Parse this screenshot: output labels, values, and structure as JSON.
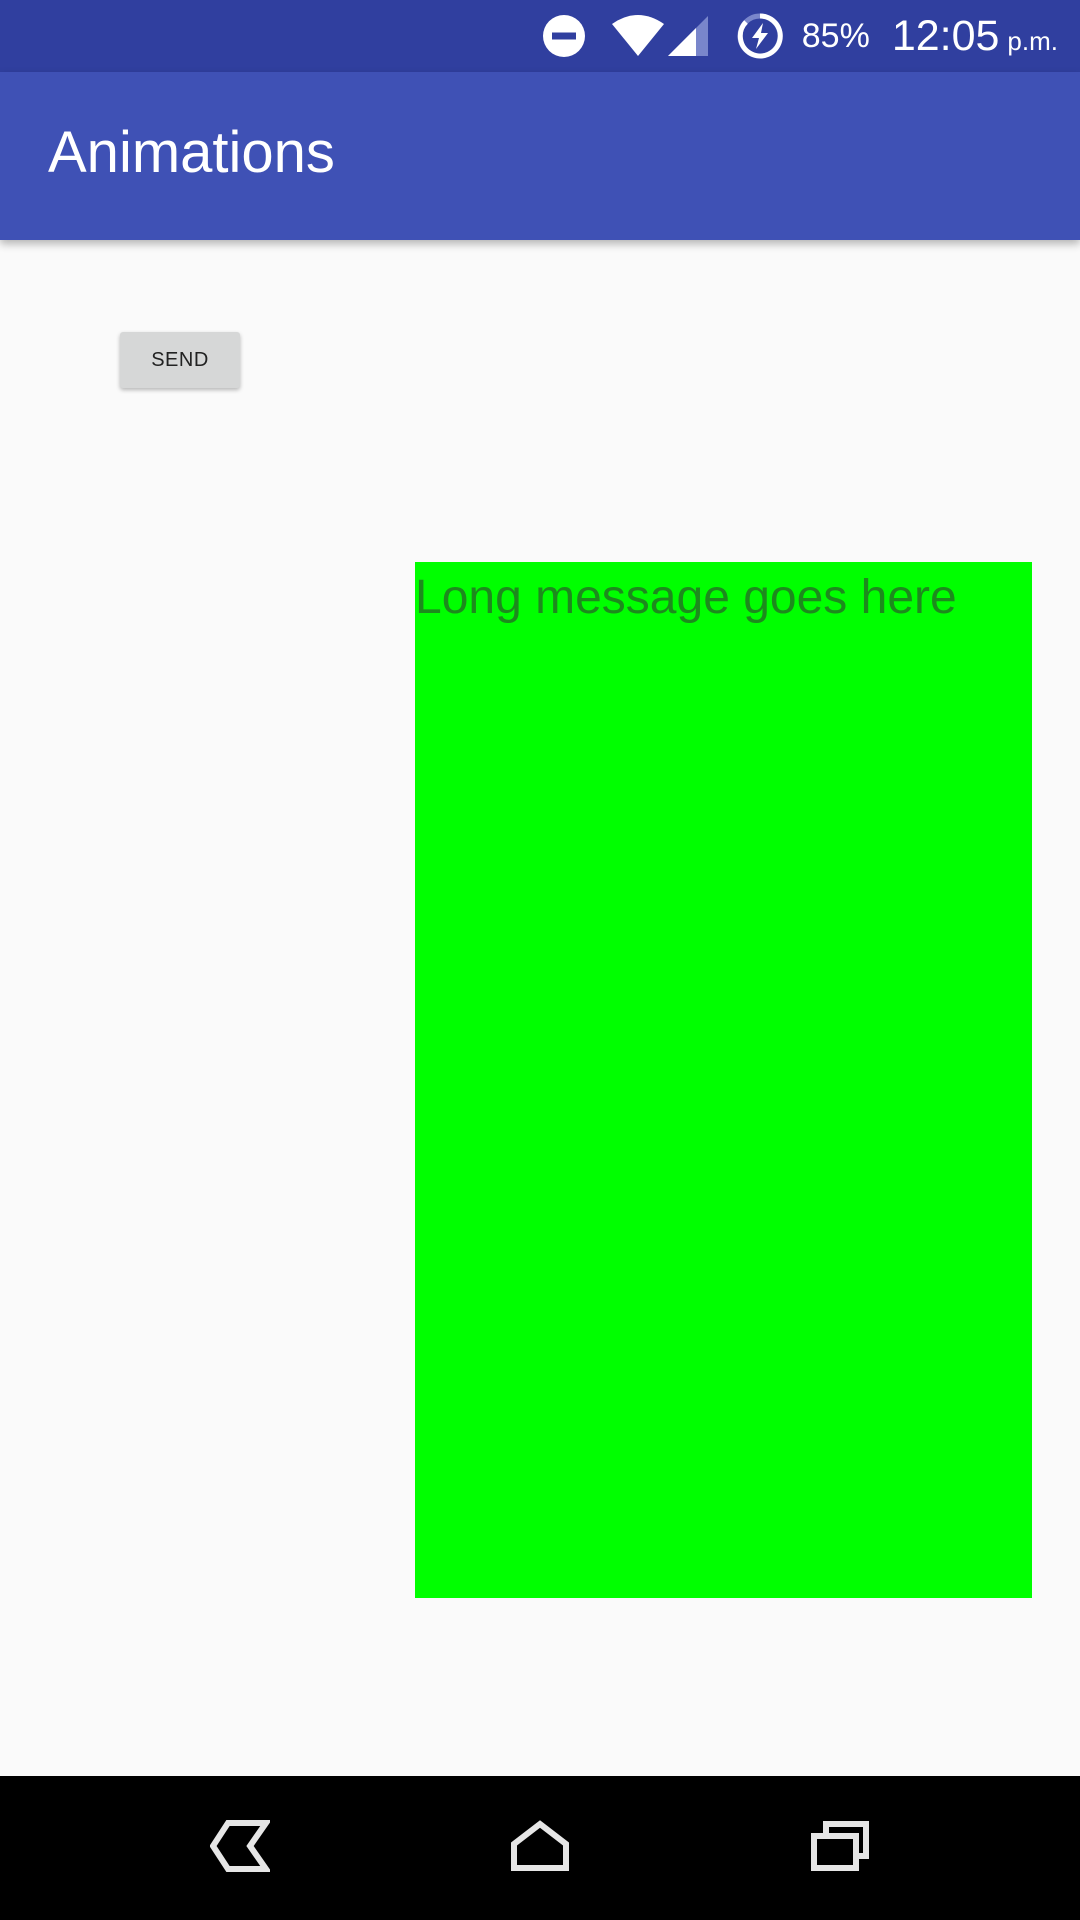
{
  "status_bar": {
    "battery_percent": "85%",
    "time": "12:05",
    "ampm": "p.m.",
    "icons": [
      "do-not-disturb-icon",
      "wifi-icon",
      "cell-signal-icon",
      "battery-charging-icon"
    ],
    "background_color": "#303f9f"
  },
  "app_bar": {
    "title": "Animations",
    "background_color": "#3f51b5"
  },
  "main": {
    "send_button_label": "SEND",
    "message_text": "Long message goes here",
    "message_background_color": "#00ff00",
    "message_text_color": "#1d8a1d"
  },
  "nav_bar": {
    "icons": [
      "back-icon",
      "home-icon",
      "recents-icon"
    ],
    "background_color": "#000000"
  }
}
